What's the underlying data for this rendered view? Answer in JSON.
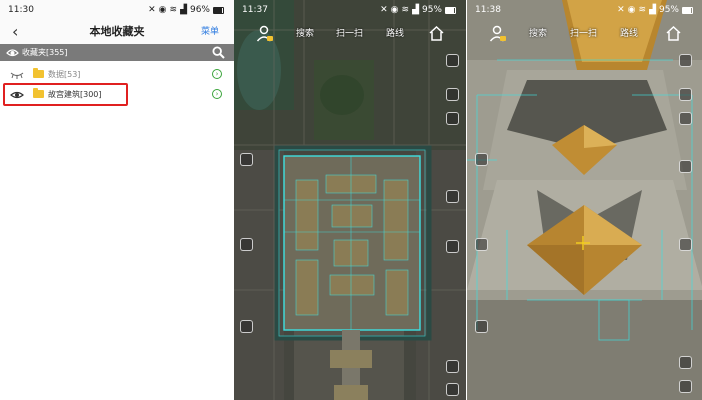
{
  "status_left": {
    "time": "11:30",
    "battery": "96%"
  },
  "status_mid": {
    "time": "11:37",
    "battery": "95%"
  },
  "status_right": {
    "time": "11:38",
    "battery": "95%"
  },
  "favorites_screen": {
    "title": "本地收藏夹",
    "menu_label": "菜单",
    "favorites_bar_label": "收藏夹[355]",
    "items": [
      {
        "label": "数据[53]",
        "visible": false
      },
      {
        "label": "故宫建筑[300]",
        "visible": true,
        "highlighted": true
      }
    ]
  },
  "map_toolbar": {
    "search": "搜索",
    "scan": "扫一扫",
    "route": "路线"
  },
  "colors": {
    "highlight_border": "#e02020",
    "folder": "#f2c230",
    "menu_link": "#2d7be0",
    "favorites_bar": "#7a7a7a",
    "overlay_line": "#3ee0e0",
    "crosshair": "#f5d020"
  },
  "icons": {
    "back": "chevron-left-icon",
    "eye": "eye-icon",
    "search": "search-icon",
    "folder": "folder-icon",
    "arrow": "circle-arrow-right-icon",
    "user": "user-location-icon",
    "home": "home-icon"
  }
}
